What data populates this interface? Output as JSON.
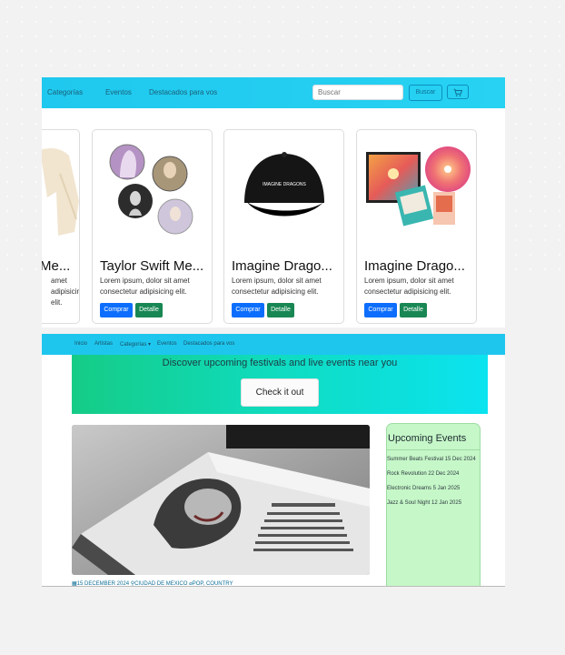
{
  "top_nav": {
    "links": [
      "Categorías",
      "Eventos",
      "Destacados para vos"
    ],
    "search_placeholder": "Buscar",
    "search_button": "Buscar",
    "cart_icon": "cart-icon"
  },
  "products": [
    {
      "title": "Me...",
      "desc": "amet adipisicing elit.",
      "image_icon": "sweatshirt-image"
    },
    {
      "title": "Taylor Swift Me...",
      "desc": "Lorem ipsum, dolor sit amet consectetur adipisicing elit.",
      "image_icon": "taylor-swift-pins-image"
    },
    {
      "title": "Imagine Drago...",
      "desc": "Lorem ipsum, dolor sit amet consectetur adipisicing elit.",
      "image_icon": "imagine-dragons-cap-image"
    },
    {
      "title": "Imagine Drago...",
      "desc": "Lorem ipsum, dolor sit amet consectetur adipisicing elit.",
      "image_icon": "album-bundle-image"
    }
  ],
  "product_buttons": {
    "buy": "Comprar",
    "detail": "Detalle"
  },
  "cap_logo_text": "IMAGINE DRAGONS",
  "bottom_nav": {
    "links": [
      "Inicio",
      "Artistas",
      "Categorías ▾",
      "Eventos",
      "Destacados para vos"
    ]
  },
  "hero": {
    "headline": "Discover upcoming festivals and live events near you",
    "cta": "Check it out"
  },
  "article_meta": "▦15 DECEMBER 2024 ⚲CIUDAD DE MEXICO ⌀POP, COUNTRY",
  "sidebar": {
    "heading": "Upcoming Events",
    "events": [
      "Summer Beats Festival 15 Dec 2024",
      "Rock Revolution 22 Dec 2024",
      "Electronic Dreams 5 Jan 2025",
      "Jazz & Soul Night 12 Jan 2025"
    ]
  },
  "colors": {
    "nav": "#1fc8ee",
    "buy_button": "#0d6efd",
    "detail_button": "#198754",
    "sidebar_bg": "#c6f7c8"
  }
}
